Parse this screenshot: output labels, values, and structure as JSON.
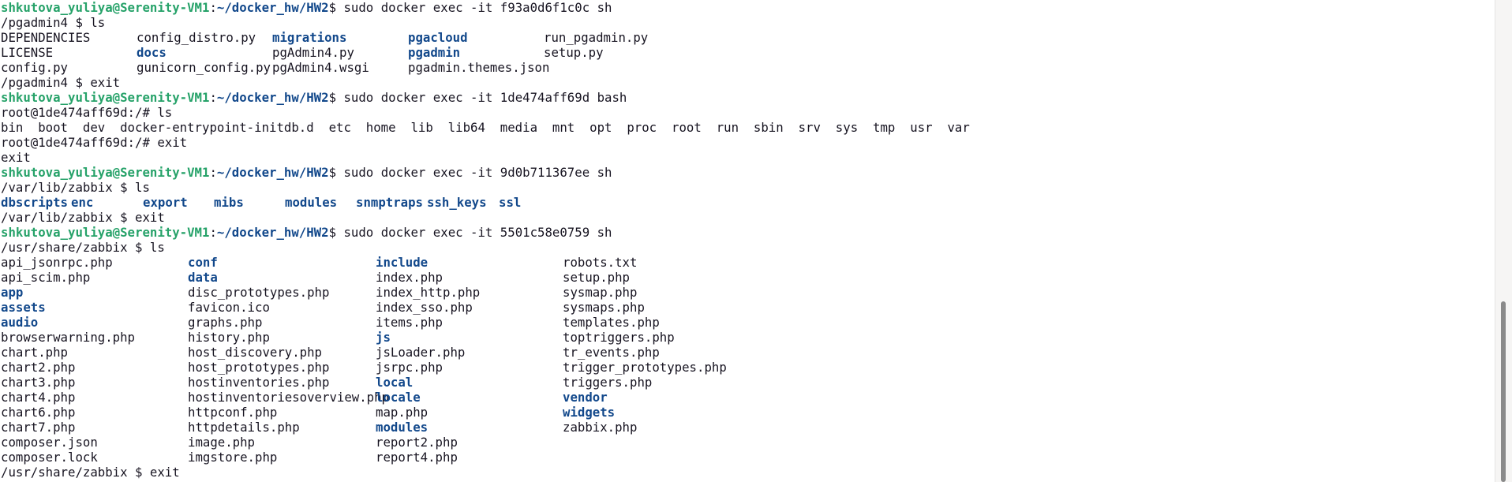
{
  "prompt": {
    "user": "shkutova_yuliya@Serenity-VM1",
    "path": "~/docker_hw/HW2"
  },
  "colors": {
    "user": "#26a269",
    "path": "#12488b",
    "directory": "#12488b",
    "text": "#171421",
    "background": "#ffffff"
  },
  "lines": [
    {
      "type": "prompt",
      "cmd": "$ sudo docker exec -it f93a0d6f1c0c sh"
    },
    {
      "type": "text",
      "text": "/pgadmin4 $ ls"
    },
    {
      "type": "ls",
      "cols": "c5a",
      "cells": [
        {
          "t": "DEPENDENCIES"
        },
        {
          "t": "config_distro.py"
        },
        {
          "t": "migrations",
          "d": true
        },
        {
          "t": "pgacloud",
          "d": true
        },
        {
          "t": "run_pgadmin.py"
        }
      ]
    },
    {
      "type": "ls",
      "cols": "c5a",
      "cells": [
        {
          "t": "LICENSE"
        },
        {
          "t": "docs",
          "d": true
        },
        {
          "t": "pgAdmin4.py"
        },
        {
          "t": "pgadmin",
          "d": true
        },
        {
          "t": "setup.py"
        }
      ]
    },
    {
      "type": "ls",
      "cols": "c5a",
      "cells": [
        {
          "t": "config.py"
        },
        {
          "t": "gunicorn_config.py"
        },
        {
          "t": "pgAdmin4.wsgi"
        },
        {
          "t": "pgadmin.themes.json"
        }
      ]
    },
    {
      "type": "text",
      "text": "/pgadmin4 $ exit"
    },
    {
      "type": "prompt",
      "cmd": "$ sudo docker exec -it 1de474aff69d bash"
    },
    {
      "type": "text",
      "text": "root@1de474aff69d:/# ls"
    },
    {
      "type": "ls",
      "cols": "c1",
      "cells": [
        {
          "t": "bin  boot  dev  docker-entrypoint-initdb.d  etc  home  lib  lib64  media  mnt  opt  proc  root  run  sbin  srv  sys  tmp  usr  var"
        }
      ]
    },
    {
      "type": "text",
      "text": "root@1de474aff69d:/# exit"
    },
    {
      "type": "text",
      "text": "exit"
    },
    {
      "type": "prompt",
      "cmd": "$ sudo docker exec -it 9d0b711367ee sh"
    },
    {
      "type": "text",
      "text": "/var/lib/zabbix $ ls"
    },
    {
      "type": "ls",
      "cols": "c8",
      "cells": [
        {
          "t": "dbscripts",
          "d": true
        },
        {
          "t": "enc",
          "d": true
        },
        {
          "t": "export",
          "d": true
        },
        {
          "t": "mibs",
          "d": true
        },
        {
          "t": "modules",
          "d": true
        },
        {
          "t": "snmptraps",
          "d": true
        },
        {
          "t": "ssh_keys",
          "d": true
        },
        {
          "t": "ssl",
          "d": true
        }
      ]
    },
    {
      "type": "text",
      "text": "/var/lib/zabbix $ exit"
    },
    {
      "type": "prompt",
      "cmd": "$ sudo docker exec -it 5501c58e0759 sh"
    },
    {
      "type": "text",
      "text": "/usr/share/zabbix $ ls"
    },
    {
      "type": "ls",
      "cols": "c4",
      "cells": [
        {
          "t": "api_jsonrpc.php"
        },
        {
          "t": "conf",
          "d": true
        },
        {
          "t": "include",
          "d": true
        },
        {
          "t": "robots.txt"
        }
      ]
    },
    {
      "type": "ls",
      "cols": "c4",
      "cells": [
        {
          "t": "api_scim.php"
        },
        {
          "t": "data",
          "d": true
        },
        {
          "t": "index.php"
        },
        {
          "t": "setup.php"
        }
      ]
    },
    {
      "type": "ls",
      "cols": "c4",
      "cells": [
        {
          "t": "app",
          "d": true
        },
        {
          "t": "disc_prototypes.php"
        },
        {
          "t": "index_http.php"
        },
        {
          "t": "sysmap.php"
        }
      ]
    },
    {
      "type": "ls",
      "cols": "c4",
      "cells": [
        {
          "t": "assets",
          "d": true
        },
        {
          "t": "favicon.ico"
        },
        {
          "t": "index_sso.php"
        },
        {
          "t": "sysmaps.php"
        }
      ]
    },
    {
      "type": "ls",
      "cols": "c4",
      "cells": [
        {
          "t": "audio",
          "d": true
        },
        {
          "t": "graphs.php"
        },
        {
          "t": "items.php"
        },
        {
          "t": "templates.php"
        }
      ]
    },
    {
      "type": "ls",
      "cols": "c4",
      "cells": [
        {
          "t": "browserwarning.php"
        },
        {
          "t": "history.php"
        },
        {
          "t": "js",
          "d": true
        },
        {
          "t": "toptriggers.php"
        }
      ]
    },
    {
      "type": "ls",
      "cols": "c4",
      "cells": [
        {
          "t": "chart.php"
        },
        {
          "t": "host_discovery.php"
        },
        {
          "t": "jsLoader.php"
        },
        {
          "t": "tr_events.php"
        }
      ]
    },
    {
      "type": "ls",
      "cols": "c4",
      "cells": [
        {
          "t": "chart2.php"
        },
        {
          "t": "host_prototypes.php"
        },
        {
          "t": "jsrpc.php"
        },
        {
          "t": "trigger_prototypes.php"
        }
      ]
    },
    {
      "type": "ls",
      "cols": "c4",
      "cells": [
        {
          "t": "chart3.php"
        },
        {
          "t": "hostinventories.php"
        },
        {
          "t": "local",
          "d": true
        },
        {
          "t": "triggers.php"
        }
      ]
    },
    {
      "type": "ls",
      "cols": "c4",
      "cells": [
        {
          "t": "chart4.php"
        },
        {
          "t": "hostinventoriesoverview.php"
        },
        {
          "t": "locale",
          "d": true
        },
        {
          "t": "vendor",
          "d": true
        }
      ]
    },
    {
      "type": "ls",
      "cols": "c4",
      "cells": [
        {
          "t": "chart6.php"
        },
        {
          "t": "httpconf.php"
        },
        {
          "t": "map.php"
        },
        {
          "t": "widgets",
          "d": true
        }
      ]
    },
    {
      "type": "ls",
      "cols": "c4",
      "cells": [
        {
          "t": "chart7.php"
        },
        {
          "t": "httpdetails.php"
        },
        {
          "t": "modules",
          "d": true
        },
        {
          "t": "zabbix.php"
        }
      ]
    },
    {
      "type": "ls",
      "cols": "c4",
      "cells": [
        {
          "t": "composer.json"
        },
        {
          "t": "image.php"
        },
        {
          "t": "report2.php"
        }
      ]
    },
    {
      "type": "ls",
      "cols": "c4",
      "cells": [
        {
          "t": "composer.lock"
        },
        {
          "t": "imgstore.php"
        },
        {
          "t": "report4.php"
        }
      ]
    },
    {
      "type": "text",
      "text": "/usr/share/zabbix $ exit"
    }
  ]
}
